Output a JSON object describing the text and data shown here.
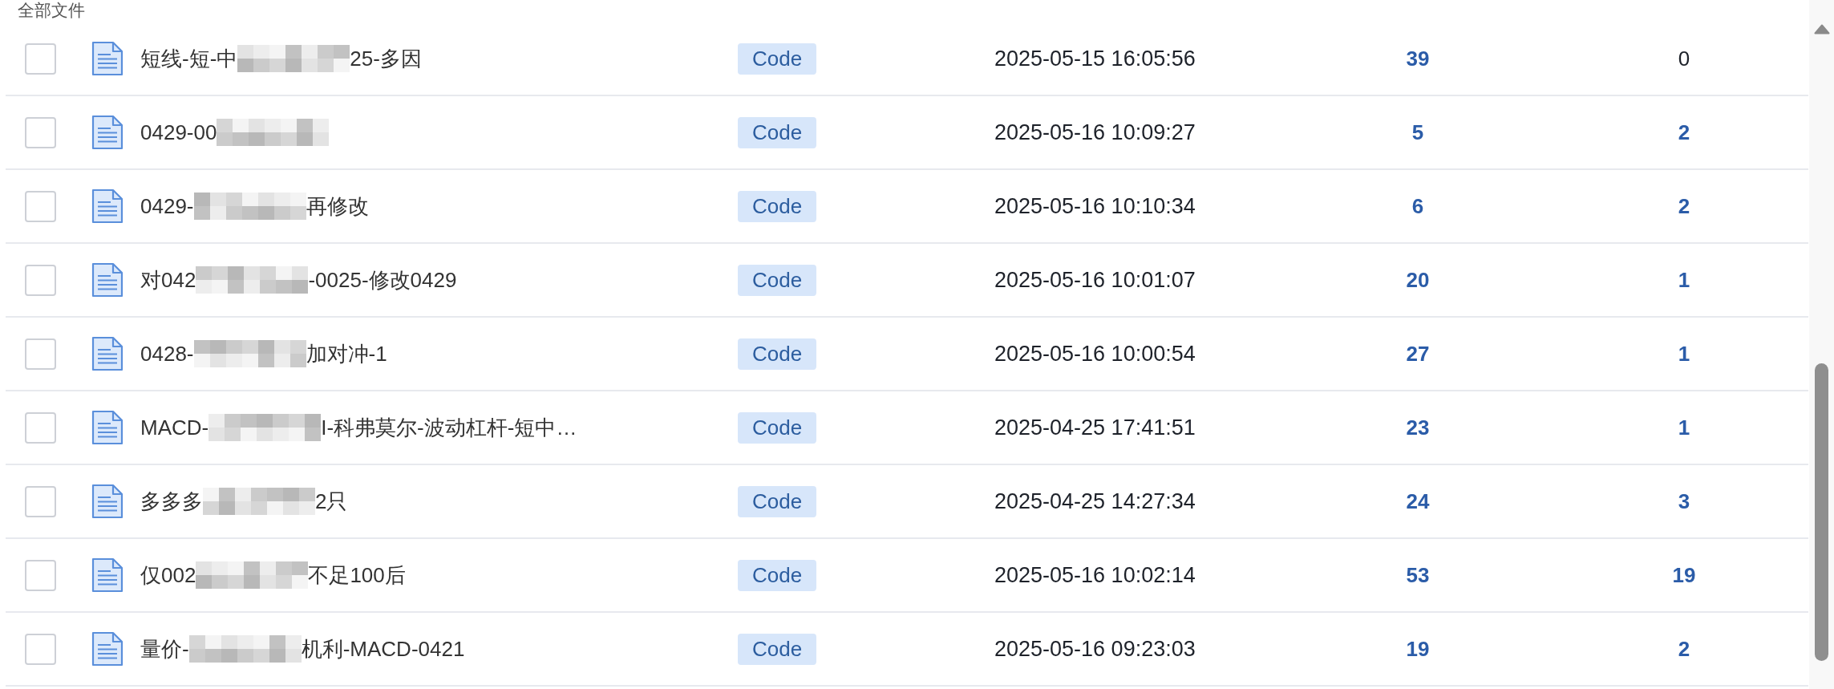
{
  "section_title": "全部文件",
  "rows": [
    {
      "checked": false,
      "name": [
        {
          "kind": "text",
          "text": "短线-短-中"
        },
        {
          "kind": "blur"
        },
        {
          "kind": "text",
          "text": "25-多因"
        }
      ],
      "tag": "Code",
      "timestamp": "2025-05-15 16:05:56",
      "column_5": {
        "text": "39",
        "linked": true
      },
      "column_6": {
        "text": "0",
        "linked": false
      }
    },
    {
      "checked": false,
      "name": [
        {
          "kind": "text",
          "text": "0429-00"
        },
        {
          "kind": "blur"
        }
      ],
      "tag": "Code",
      "timestamp": "2025-05-16 10:09:27",
      "column_5": {
        "text": "5",
        "linked": true
      },
      "column_6": {
        "text": "2",
        "linked": true
      }
    },
    {
      "checked": false,
      "name": [
        {
          "kind": "text",
          "text": "0429-"
        },
        {
          "kind": "blur"
        },
        {
          "kind": "text",
          "text": "再修改"
        }
      ],
      "tag": "Code",
      "timestamp": "2025-05-16 10:10:34",
      "column_5": {
        "text": "6",
        "linked": true
      },
      "column_6": {
        "text": "2",
        "linked": true
      }
    },
    {
      "checked": false,
      "name": [
        {
          "kind": "text",
          "text": "对042"
        },
        {
          "kind": "blur"
        },
        {
          "kind": "text",
          "text": "-0025-修改0429"
        }
      ],
      "tag": "Code",
      "timestamp": "2025-05-16 10:01:07",
      "column_5": {
        "text": "20",
        "linked": true
      },
      "column_6": {
        "text": "1",
        "linked": true
      }
    },
    {
      "checked": false,
      "name": [
        {
          "kind": "text",
          "text": "0428-"
        },
        {
          "kind": "blur"
        },
        {
          "kind": "text",
          "text": "加对冲-1"
        }
      ],
      "tag": "Code",
      "timestamp": "2025-05-16 10:00:54",
      "column_5": {
        "text": "27",
        "linked": true
      },
      "column_6": {
        "text": "1",
        "linked": true
      }
    },
    {
      "checked": false,
      "name": [
        {
          "kind": "text",
          "text": "MACD-"
        },
        {
          "kind": "blur"
        },
        {
          "kind": "text",
          "text": "I-科弗莫尔-波动杠杆-短中…"
        }
      ],
      "tag": "Code",
      "timestamp": "2025-04-25 17:41:51",
      "column_5": {
        "text": "23",
        "linked": true
      },
      "column_6": {
        "text": "1",
        "linked": true
      }
    },
    {
      "checked": false,
      "name": [
        {
          "kind": "text",
          "text": "多多多"
        },
        {
          "kind": "blur"
        },
        {
          "kind": "text",
          "text": "2只"
        }
      ],
      "tag": "Code",
      "timestamp": "2025-04-25 14:27:34",
      "column_5": {
        "text": "24",
        "linked": true
      },
      "column_6": {
        "text": "3",
        "linked": true
      }
    },
    {
      "checked": false,
      "name": [
        {
          "kind": "text",
          "text": "仅002"
        },
        {
          "kind": "blur"
        },
        {
          "kind": "text",
          "text": "不足100后"
        }
      ],
      "tag": "Code",
      "timestamp": "2025-05-16 10:02:14",
      "column_5": {
        "text": "53",
        "linked": true
      },
      "column_6": {
        "text": "19",
        "linked": true
      }
    },
    {
      "checked": false,
      "name": [
        {
          "kind": "text",
          "text": "量价-"
        },
        {
          "kind": "blur"
        },
        {
          "kind": "text",
          "text": "机利-MACD-0421"
        }
      ],
      "tag": "Code",
      "timestamp": "2025-05-16 09:23:03",
      "column_5": {
        "text": "19",
        "linked": true
      },
      "column_6": {
        "text": "2",
        "linked": true
      }
    }
  ]
}
